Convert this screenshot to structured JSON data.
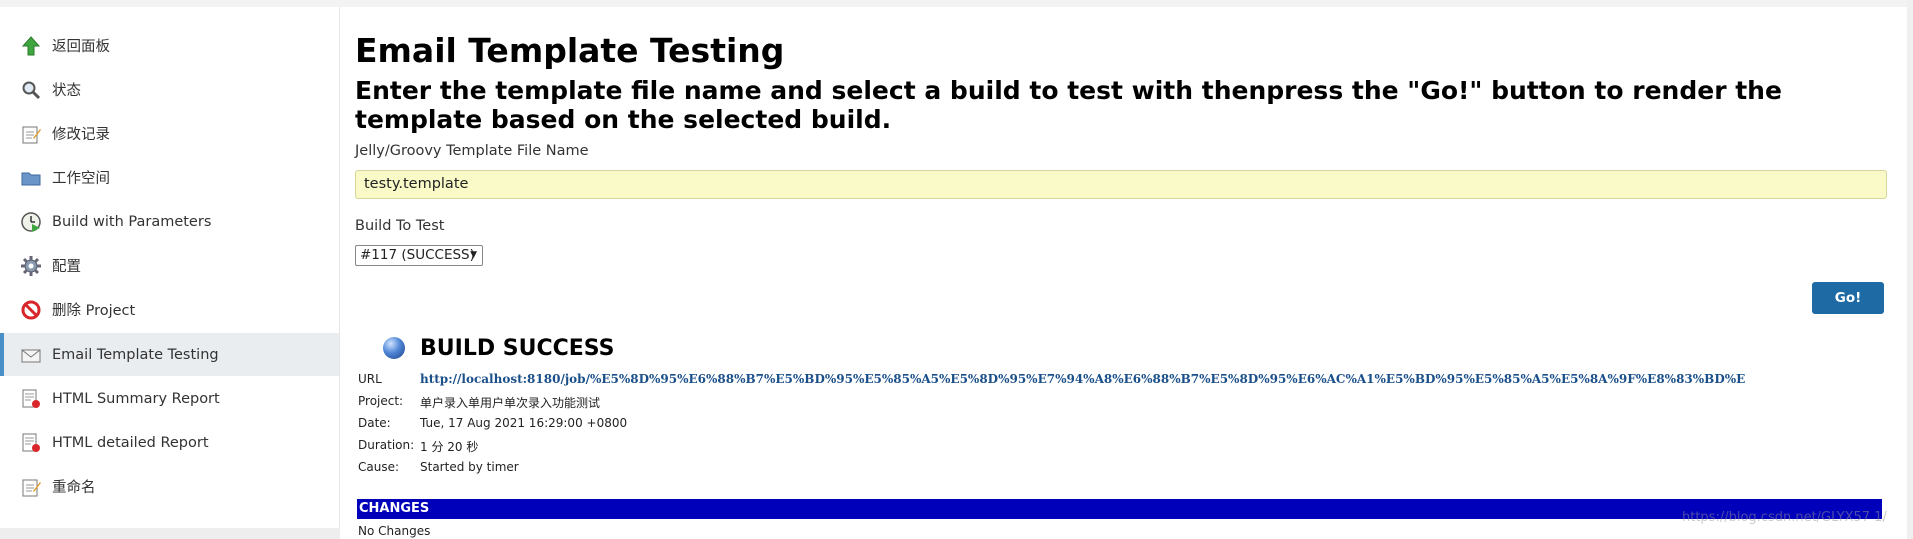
{
  "sidebar": {
    "items": [
      {
        "label": "返回面板",
        "icon": "up-arrow-icon"
      },
      {
        "label": "状态",
        "icon": "search-icon"
      },
      {
        "label": "修改记录",
        "icon": "notepad-icon"
      },
      {
        "label": "工作空间",
        "icon": "folder-icon"
      },
      {
        "label": "Build with Parameters",
        "icon": "clock-play-icon"
      },
      {
        "label": "配置",
        "icon": "gear-icon"
      },
      {
        "label": "删除 Project",
        "icon": "no-entry-icon"
      },
      {
        "label": "Email Template Testing",
        "icon": "envelope-icon"
      },
      {
        "label": "HTML Summary Report",
        "icon": "report-icon"
      },
      {
        "label": "HTML detailed Report",
        "icon": "report-icon"
      },
      {
        "label": "重命名",
        "icon": "notepad-icon"
      }
    ]
  },
  "main": {
    "title": "Email Template Testing",
    "subtitle": "Enter the template file name and select a build to test with thenpress the \"Go!\" button to render the template based on the selected build.",
    "template_label": "Jelly/Groovy Template File Name",
    "template_value": "testy.template",
    "build_label": "Build To Test",
    "build_selected": "#117 (SUCCESS)",
    "go_label": "Go!"
  },
  "result": {
    "status_title": "BUILD SUCCESS",
    "rows": [
      {
        "key": "URL",
        "value": "http://localhost:8180/job/%E5%8D%95%E6%88%B7%E5%BD%95%E5%85%A5%E5%8D%95%E7%94%A8%E6%88%B7%E5%8D%95%E6%AC%A1%E5%BD%95%E5%85%A5%E5%8A%9F%E8%83%BD%E"
      },
      {
        "key": "Project:",
        "value": "单户录入单用户单次录入功能测试"
      },
      {
        "key": "Date:",
        "value": "Tue, 17 Aug 2021 16:29:00 +0800"
      },
      {
        "key": "Duration:",
        "value": "1 分 20 秒"
      },
      {
        "key": "Cause:",
        "value": "Started by timer"
      }
    ],
    "changes_header": "CHANGES",
    "changes_text": "No Changes"
  },
  "watermark": "https://blog.csdn.net/GLYX57 1/",
  "colors": {
    "accent": "#1e6aa5",
    "changes_bar": "#0000bb",
    "input_bg": "#fafac8",
    "active_item_bg": "#e9edf0"
  }
}
